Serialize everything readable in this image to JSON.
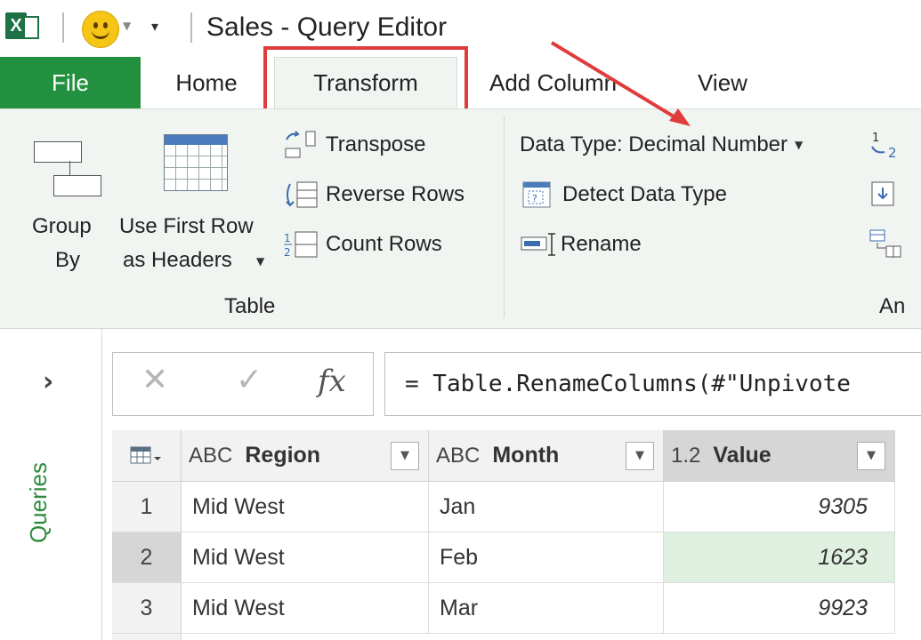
{
  "titlebar": {
    "app_icon": "excel-icon",
    "title": "Sales - Query Editor"
  },
  "tabs": [
    {
      "label": "File"
    },
    {
      "label": "Home"
    },
    {
      "label": "Transform",
      "active": true
    },
    {
      "label": "Add Column"
    },
    {
      "label": "View"
    }
  ],
  "ribbon": {
    "table_group": {
      "group_by_line1": "Group",
      "group_by_line2": "By",
      "first_row_line1": "Use First Row",
      "first_row_line2": "as Headers",
      "transpose": "Transpose",
      "reverse_rows": "Reverse Rows",
      "count_rows": "Count Rows",
      "title": "Table"
    },
    "any_column_group": {
      "data_type": "Data Type: Decimal Number",
      "detect_type": "Detect Data Type",
      "rename": "Rename",
      "title": "An"
    }
  },
  "left_pane": {
    "label": "Queries"
  },
  "formula_bar": {
    "cancel_glyph": "✕",
    "confirm_glyph": "✓",
    "fx_glyph": "fx",
    "formula": "= Table.RenameColumns(#\"Unpivote"
  },
  "grid": {
    "columns": [
      {
        "type": "ABC",
        "name": "Region"
      },
      {
        "type": "ABC",
        "name": "Month"
      },
      {
        "type": "1.2",
        "name": "Value"
      }
    ],
    "rows": [
      {
        "num": "1",
        "region": "Mid West",
        "month": "Jan",
        "value": "9305"
      },
      {
        "num": "2",
        "region": "Mid West",
        "month": "Feb",
        "value": "1623"
      },
      {
        "num": "3",
        "region": "Mid West",
        "month": "Mar",
        "value": "9923"
      }
    ]
  },
  "colors": {
    "file_tab": "#23903f",
    "highlight_box": "#e03c3c",
    "queries_label": "#2f8a3d",
    "selected_cell": "#dff0e1"
  }
}
